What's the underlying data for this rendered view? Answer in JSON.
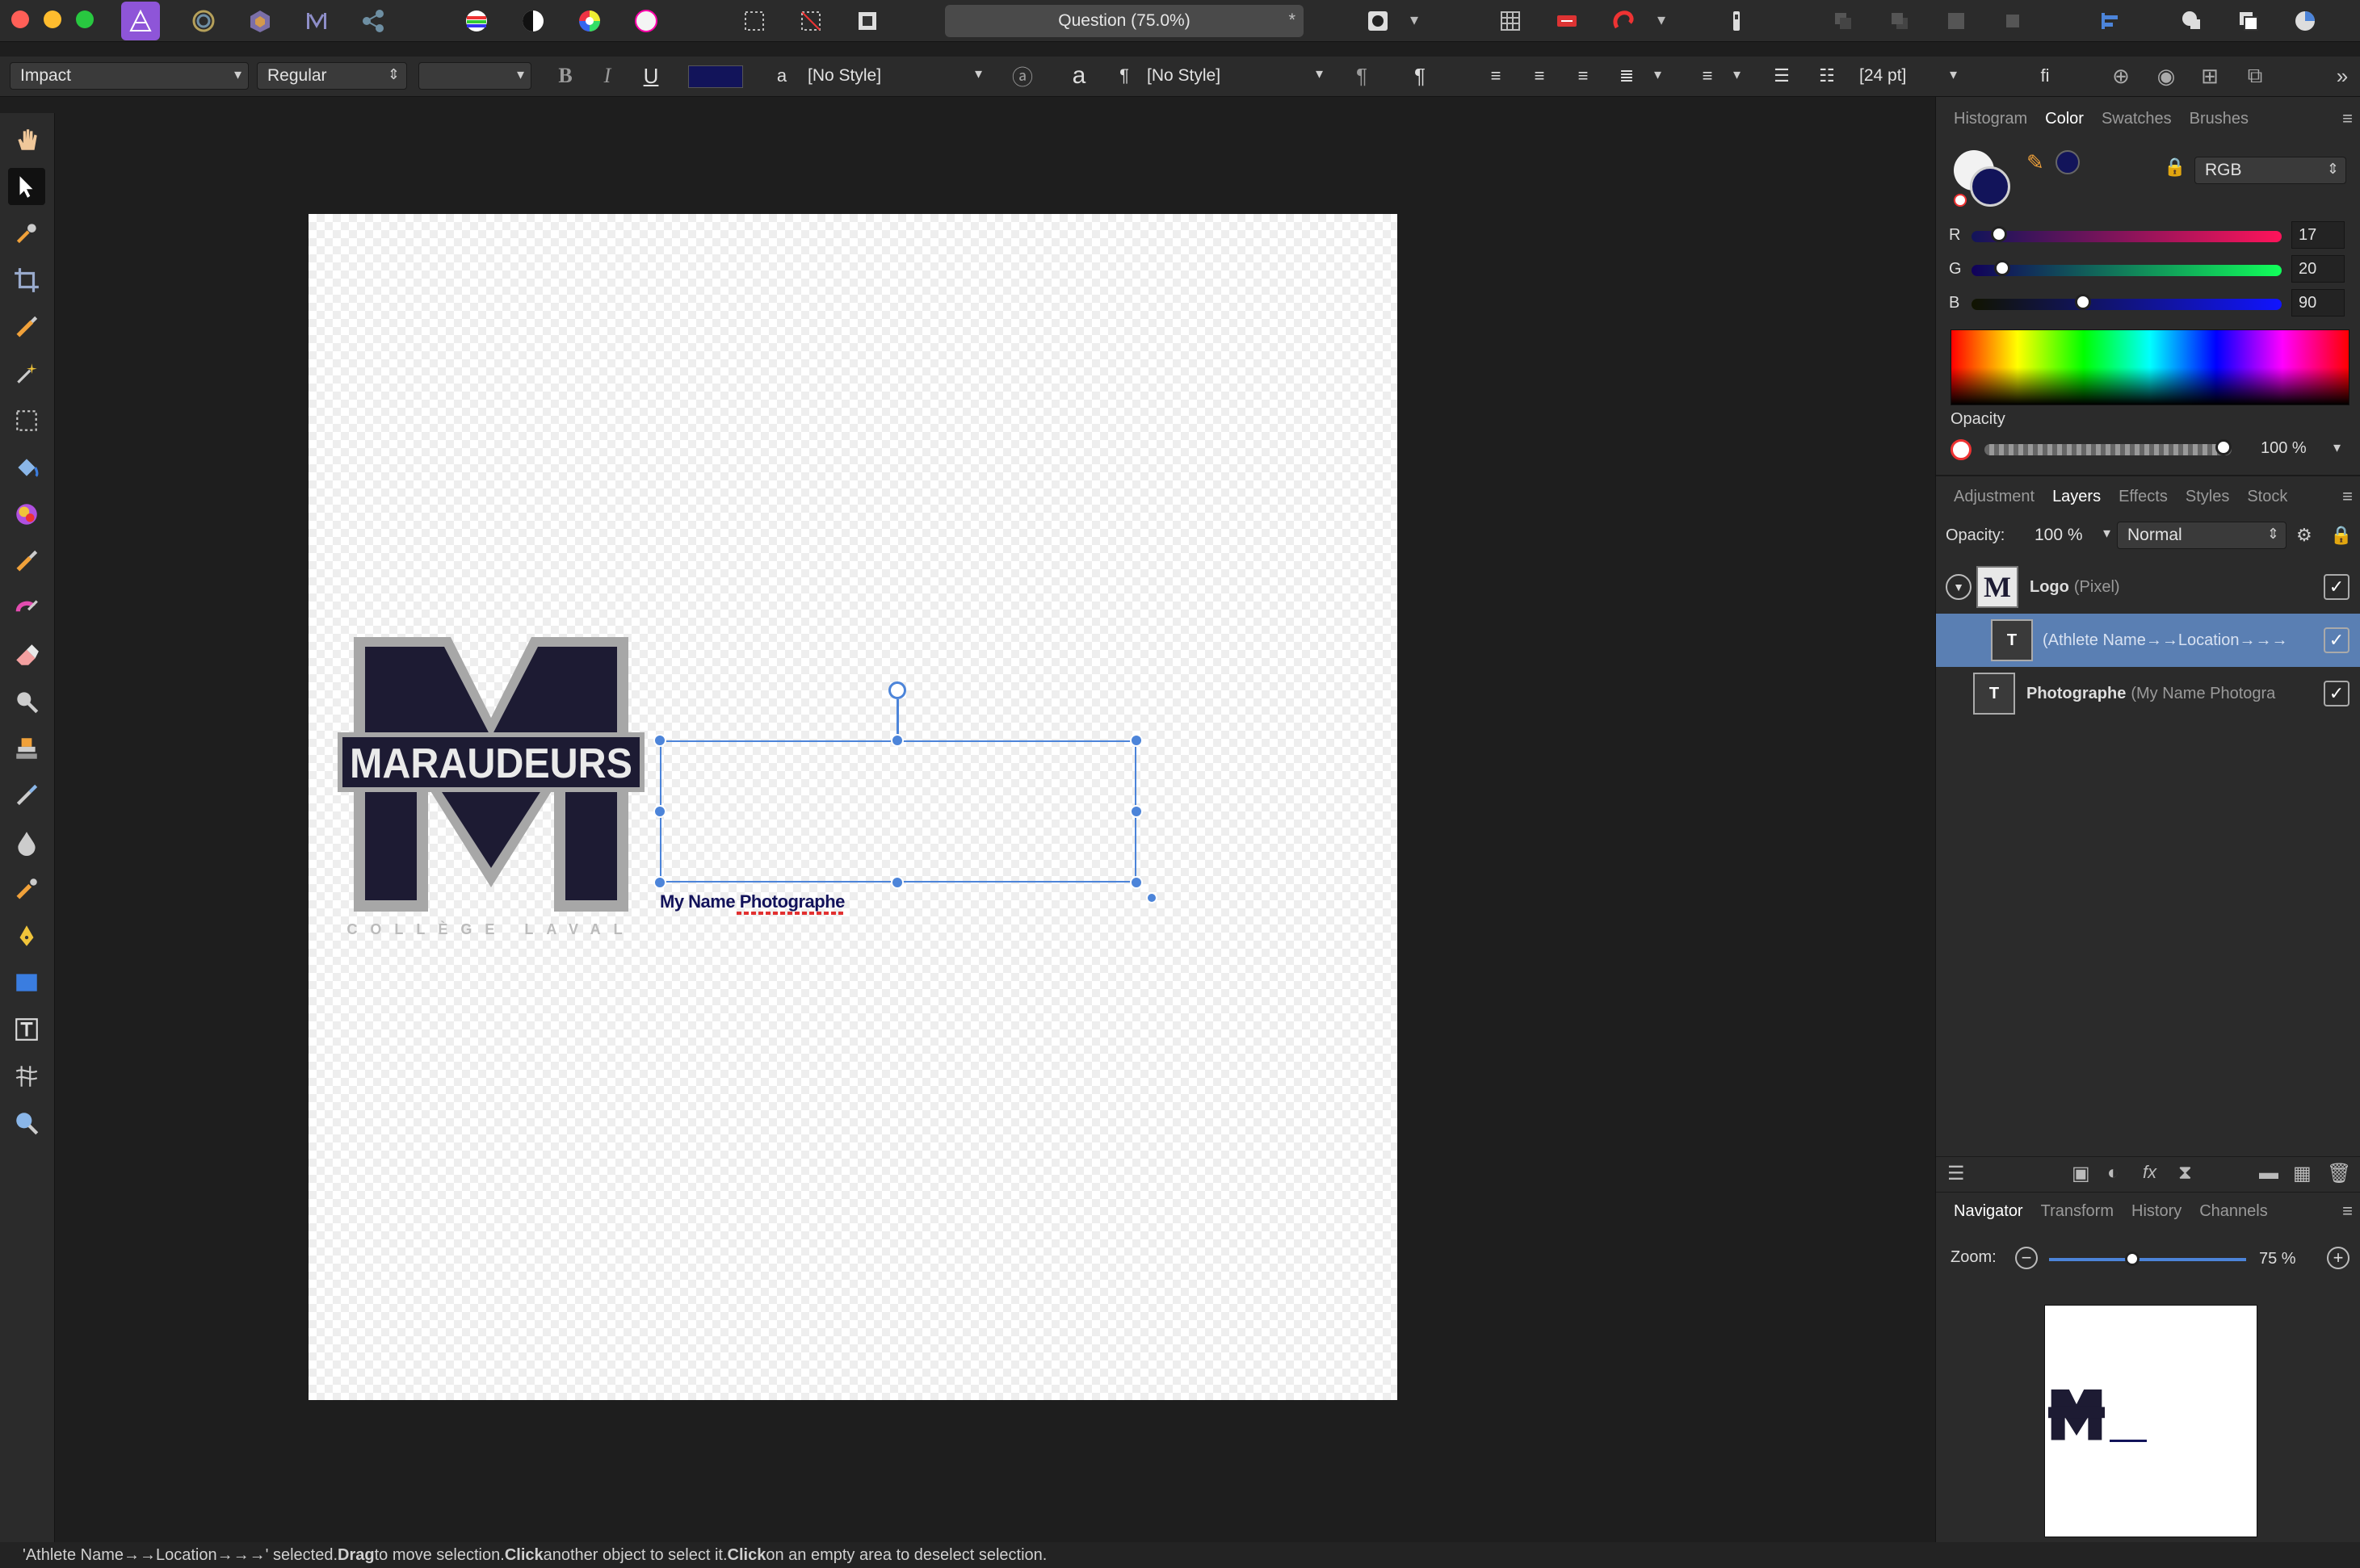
{
  "toolbar": {
    "document_title": "Question (75.0%)",
    "modified_marker": "*"
  },
  "context": {
    "font_family": "Impact",
    "font_style": "Regular",
    "font_size": "",
    "bold": "B",
    "italic": "I",
    "underline": "U",
    "char_style": "[No Style]",
    "para_style": "[No Style]",
    "leading": "[24 pt]",
    "fi_ligature": "fi",
    "fill_color": "#12145a"
  },
  "canvas": {
    "logo_word": "MARAUDEURS",
    "logo_letter": "M",
    "logo_sub": "COLLÈGE LAVAL",
    "text_frame_content": "My Name Photographe"
  },
  "color_panel": {
    "tabs": [
      "Histogram",
      "Color",
      "Swatches",
      "Brushes"
    ],
    "active_tab": "Color",
    "model": "RGB",
    "channels": [
      {
        "label": "R",
        "value": "17",
        "fraction": 0.067
      },
      {
        "label": "G",
        "value": "20",
        "fraction": 0.078
      },
      {
        "label": "B",
        "value": "90",
        "fraction": 0.353
      }
    ],
    "opacity_label": "Opacity",
    "opacity_value": "100 %",
    "opacity_fraction": 1.0
  },
  "layers_panel": {
    "tabs": [
      "Adjustment",
      "Layers",
      "Effects",
      "Styles",
      "Stock"
    ],
    "active_tab": "Layers",
    "opacity_label": "Opacity:",
    "opacity_value": "100 %",
    "blend_mode": "Normal",
    "layers": [
      {
        "name": "Logo",
        "type": "(Pixel)"
      },
      {
        "name": "",
        "type": "(Athlete Name→→Location→→→"
      },
      {
        "name": "Photographe",
        "type": "(My Name Photogra"
      }
    ]
  },
  "navigator": {
    "tabs": [
      "Navigator",
      "Transform",
      "History",
      "Channels"
    ],
    "active_tab": "Navigator",
    "zoom_label": "Zoom:",
    "zoom_value": "75 %",
    "zoom_fraction": 0.42
  },
  "status": {
    "selected": "'Athlete Name→→Location→→→' selected. ",
    "drag_b": "Drag",
    "drag_t": " to move selection. ",
    "click_b": "Click",
    "click_t": " another object to select it. ",
    "click2_b": "Click",
    "click2_t": " on an empty area to deselect selection."
  },
  "colors": {
    "accent": "#4c84d9",
    "navy": "#12145a",
    "layer_selected": "#5a7fb3"
  }
}
